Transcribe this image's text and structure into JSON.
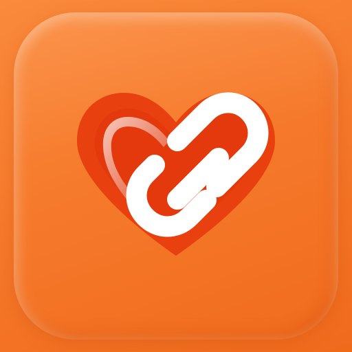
{
  "icon": {
    "colors": {
      "background": "#f67a2c",
      "heart_outer": "#e8400e",
      "heart_inner": "#e03a0a",
      "link_stroke": "#ffffff"
    },
    "icons": [
      "heart-icon",
      "link-icon"
    ]
  }
}
